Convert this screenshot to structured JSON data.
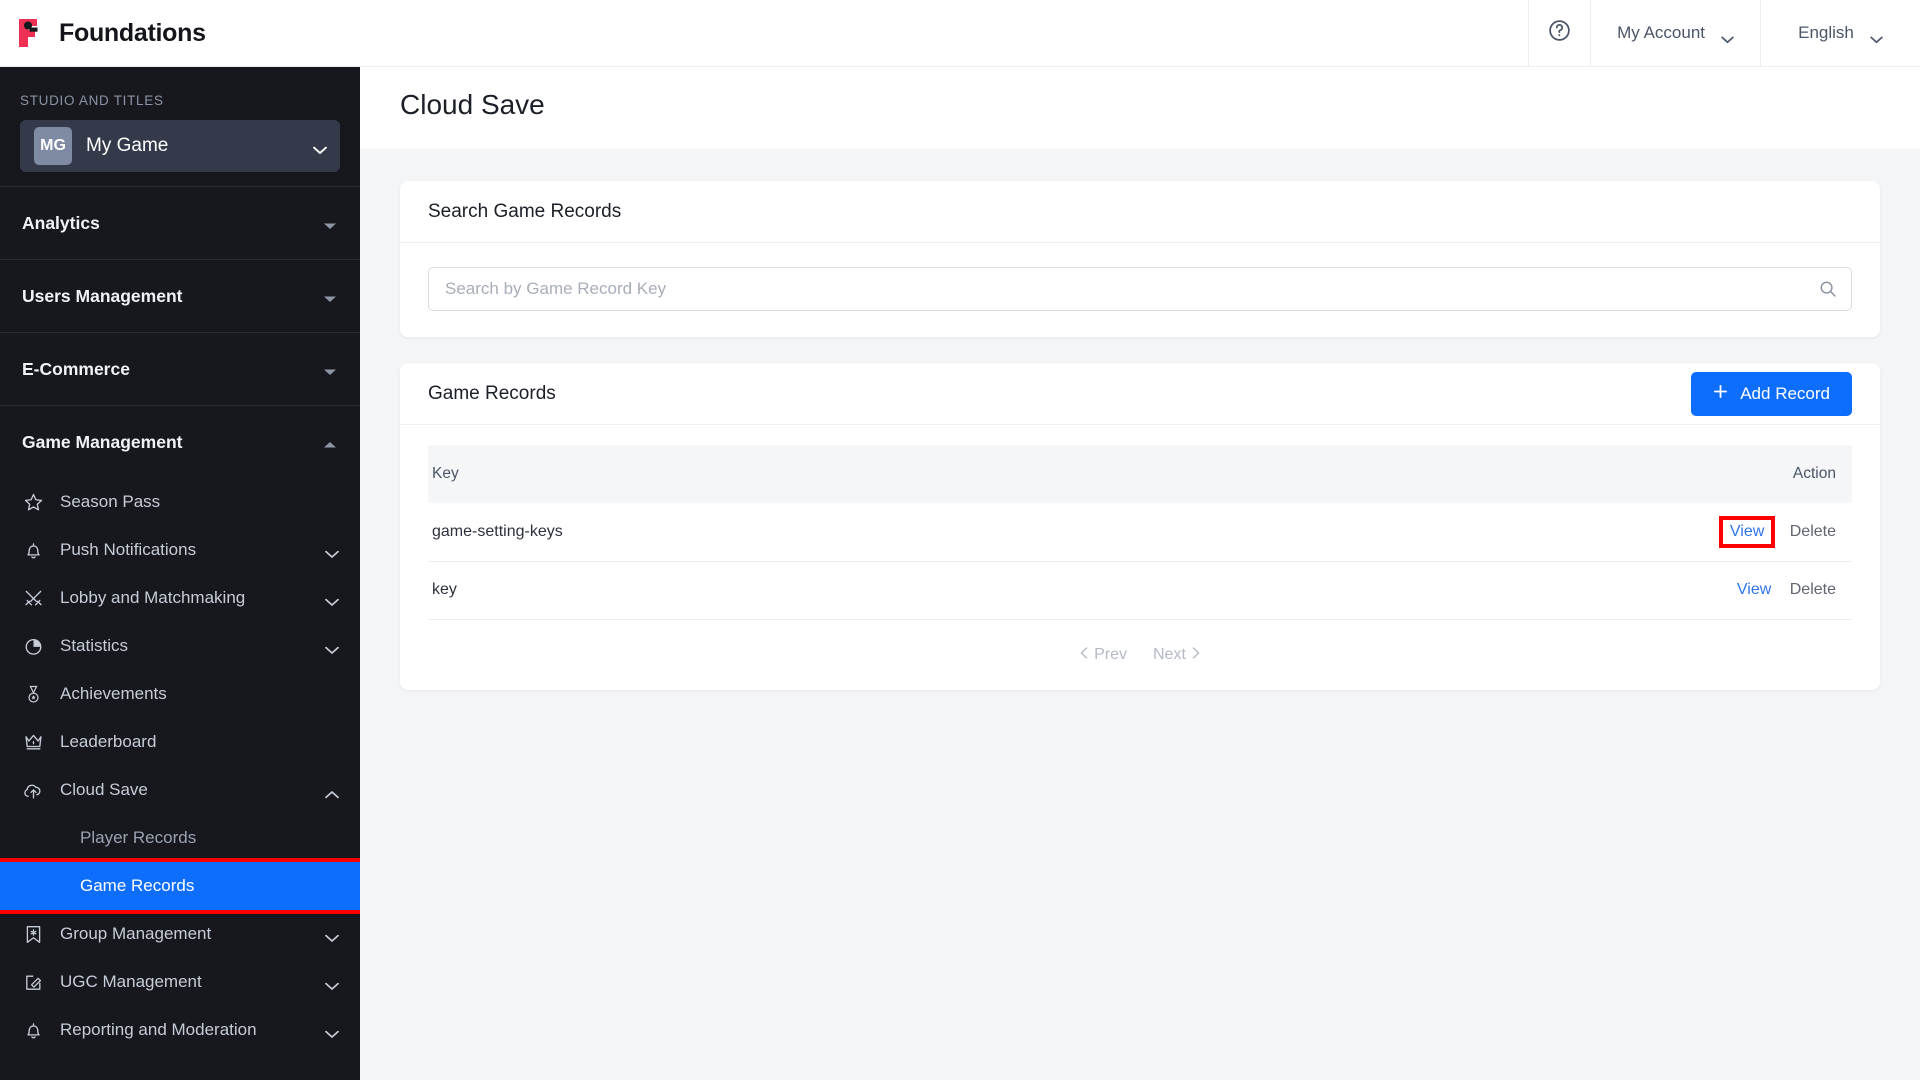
{
  "brand": {
    "name": "Foundations",
    "logo_icon": "foundations-logo-icon"
  },
  "topbar": {
    "help_icon": "help-circle-icon",
    "account_label": "My Account",
    "language_label": "English",
    "chevron_icon": "chevron-down-icon"
  },
  "sidebar": {
    "studio_label": "STUDIO AND TITLES",
    "studio": {
      "initials": "MG",
      "name": "My Game",
      "chevron_icon": "chevron-down-icon"
    },
    "sections": [
      {
        "label": "Analytics",
        "expanded": false,
        "caret_icon": "caret-down-icon"
      },
      {
        "label": "Users Management",
        "expanded": false,
        "caret_icon": "caret-down-icon"
      },
      {
        "label": "E-Commerce",
        "expanded": false,
        "caret_icon": "caret-down-icon"
      },
      {
        "label": "Game Management",
        "expanded": true,
        "caret_icon": "caret-up-icon"
      }
    ],
    "items": [
      {
        "label": "Season Pass",
        "icon": "star-icon",
        "caret": ""
      },
      {
        "label": "Push Notifications",
        "icon": "bell-icon",
        "caret": "chevron-down-icon"
      },
      {
        "label": "Lobby and Matchmaking",
        "icon": "crossed-swords-icon",
        "caret": "chevron-down-icon"
      },
      {
        "label": "Statistics",
        "icon": "pie-chart-icon",
        "caret": "chevron-down-icon"
      },
      {
        "label": "Achievements",
        "icon": "medal-icon",
        "caret": ""
      },
      {
        "label": "Leaderboard",
        "icon": "crown-icon",
        "caret": ""
      },
      {
        "label": "Cloud Save",
        "icon": "cloud-upload-icon",
        "caret": "chevron-up-icon"
      }
    ],
    "cloud_save_children": [
      {
        "label": "Player Records",
        "active": false,
        "highlighted": false
      },
      {
        "label": "Game Records",
        "active": true,
        "highlighted": true
      }
    ],
    "items_after": [
      {
        "label": "Group Management",
        "icon": "banner-flag-icon",
        "caret": "chevron-down-icon"
      },
      {
        "label": "UGC Management",
        "icon": "edit-square-icon",
        "caret": "chevron-down-icon"
      },
      {
        "label": "Reporting and Moderation",
        "icon": "bell-icon",
        "caret": "chevron-down-icon"
      }
    ]
  },
  "page": {
    "title": "Cloud Save"
  },
  "search_card": {
    "title": "Search Game Records",
    "input_value": "",
    "input_placeholder": "Search by Game Record Key",
    "search_icon": "search-icon"
  },
  "records_card": {
    "title": "Game Records",
    "add_button_label": "Add Record",
    "add_button_icon": "plus-icon",
    "columns": [
      "Key",
      "Action"
    ],
    "rows": [
      {
        "key": "game-setting-keys",
        "view_label": "View",
        "delete_label": "Delete",
        "highlighted": true
      },
      {
        "key": "key",
        "view_label": "View",
        "delete_label": "Delete",
        "highlighted": false
      }
    ],
    "pagination": {
      "prev_label": "Prev",
      "next_label": "Next",
      "prev_icon": "chevron-left-icon",
      "next_icon": "chevron-right-icon"
    }
  },
  "colors": {
    "accent": "#0d6efd",
    "link": "#2f74e8",
    "sidebar_bg": "#16181d",
    "highlight": "#ff0000",
    "brand_red": "#ef3054"
  }
}
